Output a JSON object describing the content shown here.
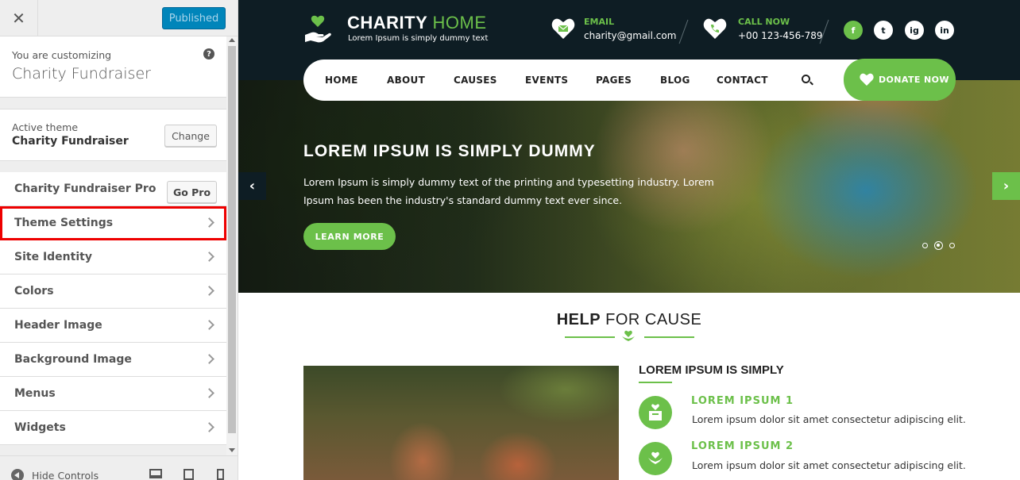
{
  "customizer": {
    "close_label": "✕",
    "publish_label": "Published",
    "customizing_label": "You are customizing",
    "site_name": "Charity Fundraiser",
    "help_label": "?",
    "active_theme_label": "Active theme",
    "theme_name": "Charity Fundraiser",
    "change_label": "Change",
    "pro_label": "Charity Fundraiser Pro",
    "gopro_label": "Go Pro",
    "sections": [
      {
        "label": "Theme Settings",
        "highlighted": true
      },
      {
        "label": "Site Identity"
      },
      {
        "label": "Colors"
      },
      {
        "label": "Header Image"
      },
      {
        "label": "Background Image"
      },
      {
        "label": "Menus"
      },
      {
        "label": "Widgets"
      }
    ],
    "hide_controls_label": "Hide Controls",
    "highlight_color": "#e00000",
    "accent_color": "#0085ba"
  },
  "site": {
    "logo_title_main": "CHARITY",
    "logo_title_accent": "HOME",
    "logo_tagline": "Lorem Ipsum is simply dummy text",
    "email_label": "EMAIL",
    "email_value": "charity@gmail.com",
    "call_label": "CALL NOW",
    "call_value": "+00 123-456-789",
    "social": [
      "f",
      "t",
      "ig",
      "in"
    ],
    "nav": [
      "HOME",
      "ABOUT",
      "CAUSES",
      "EVENTS",
      "PAGES",
      "BLOG",
      "CONTACT"
    ],
    "donate_label": "DONATE NOW",
    "hero_title": "LOREM IPSUM IS SIMPLY DUMMY",
    "hero_text": "Lorem Ipsum is simply dummy text of the printing and typesetting industry. Lorem Ipsum has been the industry's standard dummy text ever since.",
    "learn_more_label": "LEARN MORE",
    "prev_arrow": "‹",
    "next_arrow": "›",
    "section_title_bold": "HELP",
    "section_title_rest": "FOR CAUSE",
    "cause_heading": "LOREM IPSUM IS SIMPLY",
    "features": [
      {
        "title": "LOREM IPSUM 1",
        "text": "Lorem ipsum dolor sit amet consectetur adipiscing elit."
      },
      {
        "title": "LOREM IPSUM 2",
        "text": "Lorem ipsum dolor sit amet consectetur adipiscing elit."
      }
    ],
    "brand_green": "#6cc04a",
    "brand_dark": "#0e1d24"
  }
}
